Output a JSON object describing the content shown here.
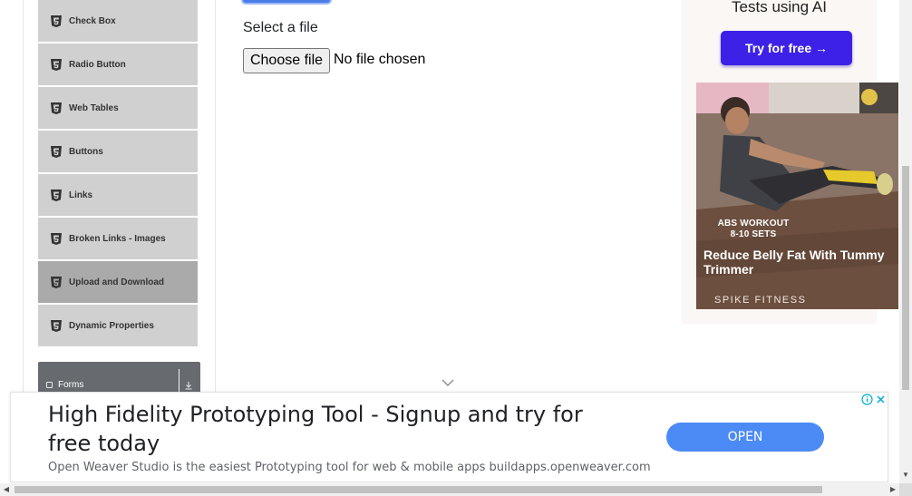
{
  "sidebar": {
    "items": [
      {
        "label": "Check Box",
        "icon": "html5-icon",
        "active": false
      },
      {
        "label": "Radio Button",
        "icon": "html5-icon",
        "active": false
      },
      {
        "label": "Web Tables",
        "icon": "html5-icon",
        "active": false
      },
      {
        "label": "Buttons",
        "icon": "html5-icon",
        "active": false
      },
      {
        "label": "Links",
        "icon": "html5-icon",
        "active": false
      },
      {
        "label": "Broken Links - Images",
        "icon": "html5-icon",
        "active": false
      },
      {
        "label": "Upload and Download",
        "icon": "html5-icon",
        "active": true
      },
      {
        "label": "Dynamic Properties",
        "icon": "html5-icon",
        "active": false
      }
    ],
    "next_group": {
      "label": "Forms",
      "icon": "document-icon",
      "toggle_icon": "download-arrow-icon"
    }
  },
  "main": {
    "upload_label": "Select a file",
    "file_button_label": "Choose file",
    "file_status": "No file chosen"
  },
  "side_ad": {
    "title": "Tests using AI",
    "cta_label": "Try for free →",
    "card": {
      "workout_text_line1": "ABS WORKOUT",
      "workout_text_line2": "8-10 SETS",
      "headline": "Reduce Belly Fat With Tummy Trimmer",
      "brand": "SPIKE FITNESS"
    }
  },
  "bottom_ad": {
    "headline": "High Fidelity Prototyping Tool - Signup and try for free today",
    "description": "Open Weaver Studio is the easiest Prototyping tool for web & mobile apps buildapps.openweaver.com",
    "cta_label": "OPEN"
  },
  "colors": {
    "sidebar_item": "#d0d0d0",
    "sidebar_item_active": "#aaaaaa",
    "group_header": "#676b70",
    "side_cta": "#3d21e6",
    "open_button": "#4c8bf5"
  }
}
